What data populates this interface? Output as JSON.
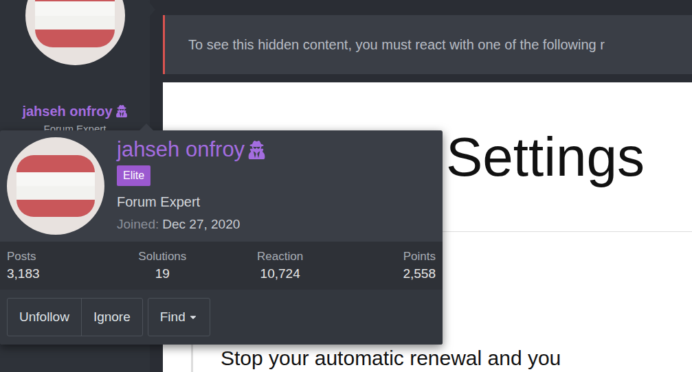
{
  "sidebar": {
    "username": "jahseh onfroy",
    "user_title": "Forum Expert"
  },
  "notice": {
    "text": "To see this hidden content, you must react with one of the following r"
  },
  "content": {
    "heading": "Settings",
    "paragraph": "Stop your automatic renewal and you"
  },
  "profile_card": {
    "username": "jahseh onfroy",
    "badge": "Elite",
    "user_title": "Forum Expert",
    "joined_label": "Joined:",
    "joined_date": "Dec 27, 2020",
    "stats": [
      {
        "label": "Posts",
        "value": "3,183"
      },
      {
        "label": "Solutions",
        "value": "19"
      },
      {
        "label": "Reaction",
        "value": "10,724"
      },
      {
        "label": "Points",
        "value": "2,558"
      }
    ],
    "buttons": [
      {
        "label": "Unfollow",
        "has_menu": false
      },
      {
        "label": "Ignore",
        "has_menu": false
      },
      {
        "label": "Find",
        "has_menu": true
      }
    ]
  }
}
